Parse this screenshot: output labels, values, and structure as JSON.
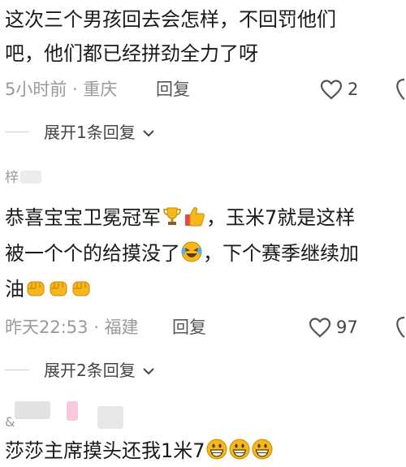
{
  "comments": [
    {
      "lines": [
        "这次三个男孩回去会怎样，不回罚他们",
        "吧，他们都已经拼劲全力了呀"
      ],
      "time": "5小时前",
      "location": "重庆",
      "reply_label": "回复",
      "likes": "2",
      "expand_label": "展开1条回复"
    },
    {
      "username": "梓",
      "line1_text": "恭喜宝宝卫冕冠军",
      "line1_tail": "，玉米7就是这样",
      "line2_text": "被一个个的给摸没了",
      "line2_tail": "，下个赛季继续加",
      "line3_text": "油",
      "time": "昨天22:53",
      "location": "福建",
      "reply_label": "回复",
      "likes": "97",
      "expand_label": "展开2条回复"
    },
    {
      "username": "&",
      "text": "莎莎主席摸头还我1米7"
    }
  ],
  "icons": {
    "heart": "heart-outline-icon",
    "dislike": "dislike-icon",
    "chevron": "chevron-down-icon",
    "trophy": "trophy-emoji",
    "thumbs": "thumbs-up-emoji",
    "laugh": "laughing-crying-emoji",
    "fist": "fist-emoji",
    "grin": "grinning-emoji"
  },
  "colors": {
    "text": "#1a1a1a",
    "meta": "#9a9a9a",
    "emoji": "#f5b81c"
  }
}
